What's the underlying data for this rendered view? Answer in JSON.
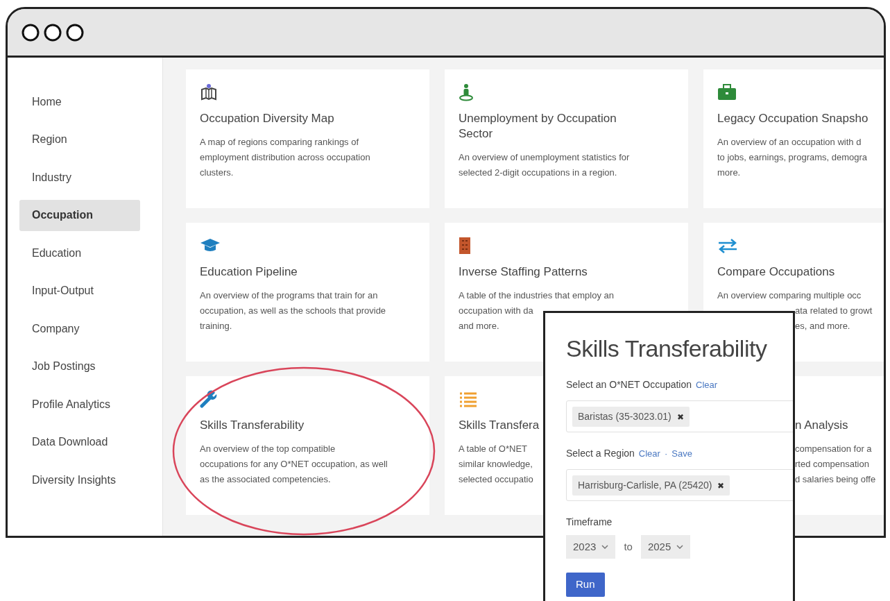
{
  "sidebar": {
    "items": [
      {
        "label": "Home",
        "selected": false
      },
      {
        "label": "Region",
        "selected": false
      },
      {
        "label": "Industry",
        "selected": false
      },
      {
        "label": "Occupation",
        "selected": true
      },
      {
        "label": "Education",
        "selected": false
      },
      {
        "label": "Input-Output",
        "selected": false
      },
      {
        "label": "Company",
        "selected": false
      },
      {
        "label": "Job Postings",
        "selected": false
      },
      {
        "label": "Profile Analytics",
        "selected": false
      },
      {
        "label": "Data Download",
        "selected": false
      },
      {
        "label": "Diversity Insights",
        "selected": false
      }
    ]
  },
  "cards": [
    {
      "title": "Occupation Diversity Map",
      "lines": [
        {
          "text": "A map of regions comparing rankings of"
        },
        {
          "text": "employment distribution across occupation"
        },
        {
          "text": "clusters."
        }
      ]
    },
    {
      "title": "Unemployment by Occupation Sector",
      "lines": [
        {
          "text": "An overview of unemployment statistics for"
        },
        {
          "text": "selected 2-digit occupations in a region."
        }
      ]
    },
    {
      "title": "Legacy Occupation Snapsho",
      "lines": [
        {
          "text": "An overview of an occupation with d"
        },
        {
          "text": "to jobs, earnings, programs, demogra"
        },
        {
          "text": "more."
        }
      ]
    },
    {
      "title": "Education Pipeline",
      "lines": [
        {
          "text": "An overview of the programs that train for an"
        },
        {
          "text": "occupation, as well as the schools that provide"
        },
        {
          "text": "training."
        }
      ]
    },
    {
      "title": "Inverse Staffing Patterns",
      "lines": [
        {
          "text": "A table of the industries that employ an"
        },
        {
          "text": "occupation with da"
        },
        {
          "text": "and more."
        }
      ]
    },
    {
      "title": "Compare Occupations",
      "lines": [
        {
          "text": "An overview comparing multiple occ"
        },
        {
          "text": "ata related to growt",
          "covered": true
        },
        {
          "text": "es, and more.",
          "covered": true
        }
      ]
    },
    {
      "title": "Skills Transferability",
      "lines": [
        {
          "text": "An overview of the top compatible"
        },
        {
          "text": "occupations for any O*NET occupation, as well"
        },
        {
          "text": "as the associated competencies."
        }
      ],
      "highlighted": true
    },
    {
      "title": "Skills Transfera",
      "lines": [
        {
          "text": "A table of O*NET"
        },
        {
          "text": "similar knowledge,"
        },
        {
          "text": "selected occupatio"
        }
      ]
    },
    {
      "title": "n Analysis",
      "title_covered": true,
      "lines": [
        {
          "text": "compensation for a",
          "covered": true
        },
        {
          "text": "rted compensation",
          "covered": true
        },
        {
          "text": "d salaries being offe",
          "covered": true
        }
      ]
    }
  ],
  "popup": {
    "title": "Skills Transferability",
    "occupation": {
      "label": "Select an O*NET Occupation",
      "links": [
        "Clear"
      ],
      "token": "Baristas (35-3023.01)",
      "remove": "✖"
    },
    "region": {
      "label": "Select a Region",
      "links": [
        "Clear",
        "Save"
      ],
      "separator": "·",
      "token": "Harrisburg-Carlisle, PA (25420)",
      "remove": "✖"
    },
    "timeframe": {
      "label": "Timeframe",
      "from": "2023",
      "joiner": "to",
      "to": "2025"
    },
    "run_button": "Run"
  }
}
